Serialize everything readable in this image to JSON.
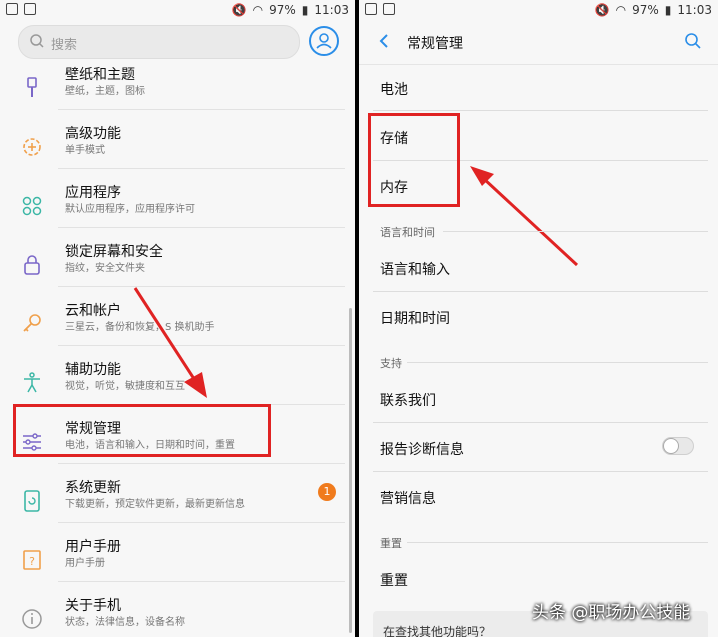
{
  "status_bar": {
    "battery": "97%",
    "time": "11:03"
  },
  "left": {
    "search_placeholder": "搜索",
    "items": [
      {
        "title": "壁纸和主题",
        "subtitle": "壁纸，主题，图标",
        "icon": "paintbrush-icon"
      },
      {
        "title": "高级功能",
        "subtitle": "单手模式",
        "icon": "gear-plus-icon"
      },
      {
        "title": "应用程序",
        "subtitle": "默认应用程序，应用程序许可",
        "icon": "apps-grid-icon"
      },
      {
        "title": "锁定屏幕和安全",
        "subtitle": "指纹，安全文件夹",
        "icon": "lock-icon"
      },
      {
        "title": "云和帐户",
        "subtitle": "三星云，备份和恢复，S 换机助手",
        "icon": "key-icon"
      },
      {
        "title": "辅助功能",
        "subtitle": "视觉，听觉，敏捷度和互互",
        "icon": "accessibility-icon"
      },
      {
        "title": "常规管理",
        "subtitle": "电池，语言和输入，日期和时间，重置",
        "icon": "sliders-icon"
      },
      {
        "title": "系统更新",
        "subtitle": "下载更新，预定软件更新，最新更新信息",
        "icon": "update-icon",
        "badge": "1"
      },
      {
        "title": "用户手册",
        "subtitle": "用户手册",
        "icon": "help-book-icon"
      },
      {
        "title": "关于手机",
        "subtitle": "状态，法律信息，设备名称",
        "icon": "info-icon"
      }
    ]
  },
  "right": {
    "header_title": "常规管理",
    "battery": "电池",
    "storage": "存储",
    "memory": "内存",
    "section_language": "语言和时间",
    "language_input": "语言和输入",
    "date_time": "日期和时间",
    "section_support": "支持",
    "contact_us": "联系我们",
    "report_diagnostics": "报告诊断信息",
    "report_diagnostics_on": false,
    "marketing_info": "营销信息",
    "section_reset": "重置",
    "reset": "重置",
    "promo_text": "在查找其他功能吗？"
  },
  "watermark": "头条 @职场办公技能",
  "colors": {
    "accent_blue": "#2b8ee8",
    "highlight_red": "#e02323",
    "badge_orange": "#f07b1d",
    "icon_orange": "#f0a04b",
    "icon_teal": "#3cb7a6",
    "icon_purple": "#7a67c8"
  }
}
